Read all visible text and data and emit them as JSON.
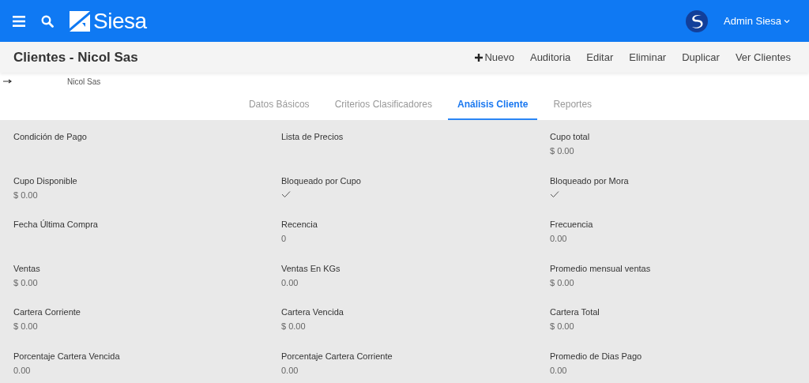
{
  "header": {
    "brand": "Siesa",
    "user": "Admin Siesa"
  },
  "title": "Clientes - Nicol Sas",
  "actions": [
    {
      "label": "Nuevo",
      "kind": "add"
    },
    {
      "label": "Auditoria",
      "kind": "plain"
    },
    {
      "label": "Editar",
      "kind": "plain"
    },
    {
      "label": "Eliminar",
      "kind": "plain"
    },
    {
      "label": "Duplicar",
      "kind": "plain"
    },
    {
      "label": "Ver Clientes",
      "kind": "plain"
    }
  ],
  "breadcrumb": "Nicol Sas",
  "tabs": [
    {
      "label": "Datos Básicos",
      "selected": false
    },
    {
      "label": "Criterios Clasificadores",
      "selected": false
    },
    {
      "label": "Análisis Cliente",
      "selected": true
    },
    {
      "label": "Reportes",
      "selected": false
    }
  ],
  "fields": [
    {
      "label": "Condición de Pago",
      "kind": "text"
    },
    {
      "label": "Lista de Precios",
      "kind": "text"
    },
    {
      "label": "Cupo total",
      "kind": "text",
      "value": "$ 0.00"
    },
    {
      "label": "Cupo Disponible",
      "kind": "text",
      "value": "$ 0.00"
    },
    {
      "label": "Bloqueado por Cupo",
      "kind": "check",
      "checked": true
    },
    {
      "label": "Bloqueado por Mora",
      "kind": "check",
      "checked": true
    },
    {
      "label": "Fecha Última Compra",
      "kind": "text"
    },
    {
      "label": "Recencia",
      "kind": "text",
      "value": "0"
    },
    {
      "label": "Frecuencia",
      "kind": "text",
      "value": "0.00"
    },
    {
      "label": "Ventas",
      "kind": "text",
      "value": "$ 0.00"
    },
    {
      "label": "Ventas En KGs",
      "kind": "text",
      "value": "0.00"
    },
    {
      "label": "Promedio mensual ventas",
      "kind": "text",
      "value": "$ 0.00"
    },
    {
      "label": "Cartera Corriente",
      "kind": "text",
      "value": "$ 0.00"
    },
    {
      "label": "Cartera Vencida",
      "kind": "text",
      "value": "$ 0.00"
    },
    {
      "label": "Cartera Total",
      "kind": "text",
      "value": "$ 0.00"
    },
    {
      "label": "Porcentaje Cartera Vencida",
      "kind": "text",
      "value": "0.00"
    },
    {
      "label": "Porcentaje Cartera Corriente",
      "kind": "text",
      "value": "0.00"
    },
    {
      "label": "Promedio de Dias Pago",
      "kind": "text",
      "value": "0.00"
    }
  ]
}
